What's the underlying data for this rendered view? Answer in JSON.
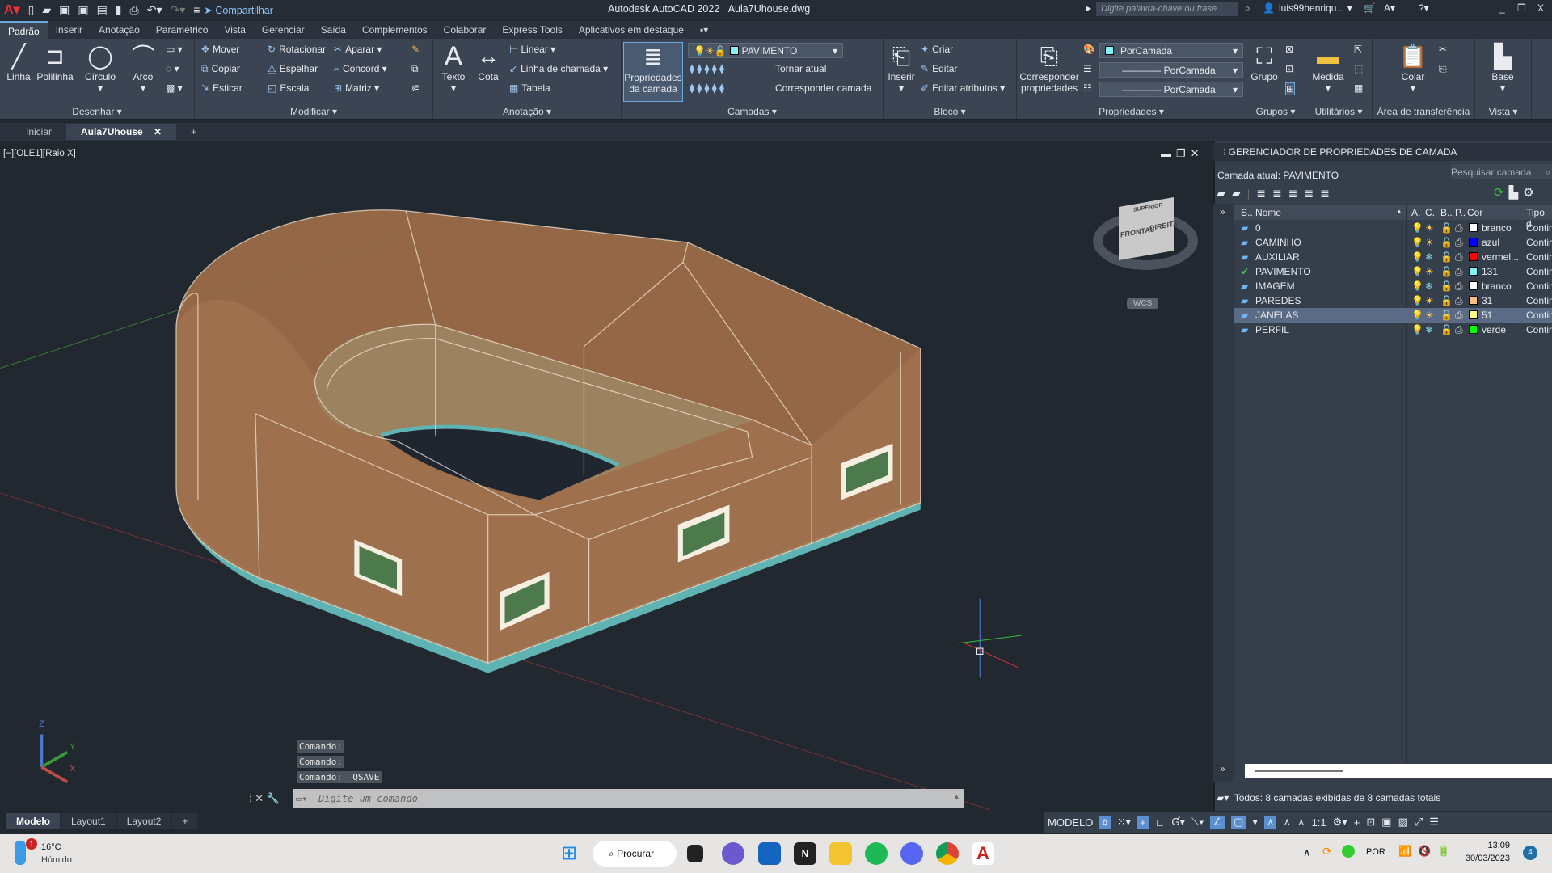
{
  "titlebar": {
    "app_icon": "autocad-logo",
    "share": "Compartilhar",
    "title": "Autodesk AutoCAD 2022",
    "file": "Aula7Uhouse.dwg",
    "search_placeholder": "Digite palavra-chave ou frase",
    "user": "luis99henriqu...",
    "win_min": "_",
    "win_restore": "❐",
    "win_close": "X"
  },
  "ribbon_tabs": [
    "Padrão",
    "Inserir",
    "Anotação",
    "Paramétrico",
    "Vista",
    "Gerenciar",
    "Saída",
    "Complementos",
    "Colaborar",
    "Express Tools",
    "Aplicativos em destaque"
  ],
  "ribbon": {
    "desenhar": {
      "label": "Desenhar ▾",
      "linha": "Linha",
      "polilinha": "Polilinha",
      "circulo": "Círculo",
      "arco": "Arco"
    },
    "modificar": {
      "label": "Modificar ▾",
      "items": [
        "Mover",
        "Rotacionar",
        "Aparar ▾",
        "Copiar",
        "Espelhar",
        "Concord ▾",
        "Esticar",
        "Escala",
        "Matriz ▾"
      ]
    },
    "anotacao": {
      "label": "Anotação ▾",
      "texto": "Texto",
      "cota": "Cota",
      "items": [
        "Linear ▾",
        "Linha de chamada ▾",
        "Tabela"
      ]
    },
    "camadas": {
      "label": "Camadas ▾",
      "props": "Propriedades da camada",
      "current": "PAVIMENTO",
      "tornar": "Tornar atual",
      "corresponder": "Corresponder camada",
      "current_color": "#7ff3f5"
    },
    "bloco": {
      "label": "Bloco ▾",
      "inserir": "Inserir",
      "items": [
        "Criar",
        "Editar",
        "Editar atributos ▾"
      ]
    },
    "propriedades": {
      "label": "Propriedades ▾",
      "corresponder": "Corresponder propriedades",
      "color": "PorCamada",
      "linetype": "PorCamada",
      "lineweight": "PorCamada"
    },
    "grupos": {
      "label": "Grupos ▾",
      "grupo": "Grupo"
    },
    "utilitarios": {
      "label": "Utilitários ▾",
      "medida": "Medida"
    },
    "transferencia": {
      "label": "Área de transferência",
      "colar": "Colar"
    },
    "vista": {
      "label": "Vista ▾",
      "base": "Base"
    }
  },
  "file_tabs": {
    "start": "Iniciar",
    "active": "Aula7Uhouse",
    "close": "✕",
    "add": "+"
  },
  "viewport": {
    "label": "[−][OLE1][Raio X]",
    "viewcube": {
      "front": "FRONTAL",
      "right": "DIREITA",
      "top": "SUPERIOR"
    },
    "wcs": "WCS",
    "ucs": {
      "x": "X",
      "y": "Y",
      "z": "Z"
    }
  },
  "layer_panel": {
    "title": "GERENCIADOR DE PROPRIEDADES DE CAMADA",
    "current": "Camada atual: PAVIMENTO",
    "search_placeholder": "Pesquisar camada",
    "columns": [
      "S..",
      "Nome",
      "A.",
      "C.",
      "B..",
      "P..",
      "Cor",
      "Tipo d"
    ],
    "layers": [
      {
        "name": "0",
        "status": "layer",
        "frozen": false,
        "color": "#ffffff",
        "color_name": "branco",
        "linetype": "Contin"
      },
      {
        "name": "CAMINHO",
        "status": "layer",
        "frozen": false,
        "color": "#0000ff",
        "color_name": "azul",
        "linetype": "Contin"
      },
      {
        "name": "AUXILIAR",
        "status": "layer",
        "frozen": true,
        "color": "#ff0000",
        "color_name": "vermel...",
        "linetype": "Contin"
      },
      {
        "name": "PAVIMENTO",
        "status": "current",
        "frozen": false,
        "color": "#7ff3f5",
        "color_name": "131",
        "linetype": "Contin"
      },
      {
        "name": "IMAGEM",
        "status": "layer",
        "frozen": true,
        "color": "#ffffff",
        "color_name": "branco",
        "linetype": "Contin"
      },
      {
        "name": "PAREDES",
        "status": "layer",
        "frozen": false,
        "color": "#ffbf7f",
        "color_name": "31",
        "linetype": "Contin"
      },
      {
        "name": "JANELAS",
        "status": "layer",
        "frozen": false,
        "color": "#ffff7f",
        "color_name": "51",
        "linetype": "Contin",
        "selected": true
      },
      {
        "name": "PERFIL",
        "status": "layer",
        "frozen": true,
        "color": "#00ff00",
        "color_name": "verde",
        "linetype": "Contin"
      }
    ],
    "footer": "Todos: 8 camadas exibidas de 8 camadas totais"
  },
  "command": {
    "history": [
      "Comando:",
      "Comando:",
      "Comando:  _QSAVE"
    ],
    "placeholder": "Digite um comando"
  },
  "layout_tabs": [
    "Modelo",
    "Layout1",
    "Layout2",
    "+"
  ],
  "status": {
    "model": "MODELO",
    "scale": "1:1"
  },
  "taskbar": {
    "temp": "16°C",
    "weather": "Húmido",
    "weather_badge": "1",
    "search": "Procurar",
    "lang": "POR",
    "time": "13:09",
    "date": "30/03/2023",
    "notif": "4"
  }
}
